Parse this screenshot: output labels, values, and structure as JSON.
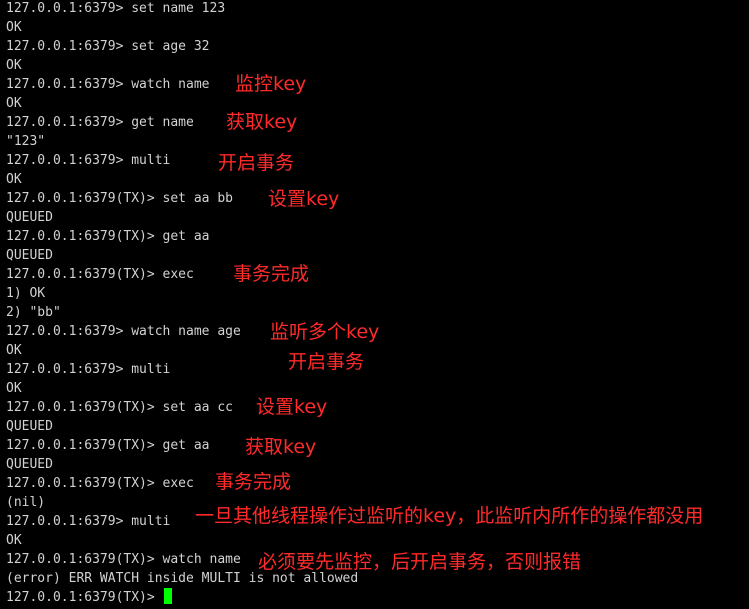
{
  "colors": {
    "background": "#000000",
    "terminal_text": "#d2d2d2",
    "annotation_text": "#ff2a2a",
    "cursor": "#00ff00"
  },
  "lines": [
    "127.0.0.1:6379> set name 123",
    "OK",
    "127.0.0.1:6379> set age 32",
    "OK",
    "127.0.0.1:6379> watch name",
    "OK",
    "127.0.0.1:6379> get name",
    "\"123\"",
    "127.0.0.1:6379> multi",
    "OK",
    "127.0.0.1:6379(TX)> set aa bb",
    "QUEUED",
    "127.0.0.1:6379(TX)> get aa",
    "QUEUED",
    "127.0.0.1:6379(TX)> exec",
    "1) OK",
    "2) \"bb\"",
    "127.0.0.1:6379> watch name age",
    "OK",
    "127.0.0.1:6379> multi",
    "OK",
    "127.0.0.1:6379(TX)> set aa cc",
    "QUEUED",
    "127.0.0.1:6379(TX)> get aa",
    "QUEUED",
    "127.0.0.1:6379(TX)> exec",
    "(nil)",
    "127.0.0.1:6379> multi",
    "OK",
    "127.0.0.1:6379(TX)> watch name",
    "(error) ERR WATCH inside MULTI is not allowed",
    "127.0.0.1:6379(TX)> "
  ],
  "annotations": [
    "监控key",
    "获取key",
    "开启事务",
    "设置key",
    "事务完成",
    "监听多个key",
    "开启事务",
    "设置key",
    "获取key",
    "事务完成",
    "一旦其他线程操作过监听的key，此监听内所作的操作都没用",
    "必须要先监控，后开启事务，否则报错"
  ]
}
